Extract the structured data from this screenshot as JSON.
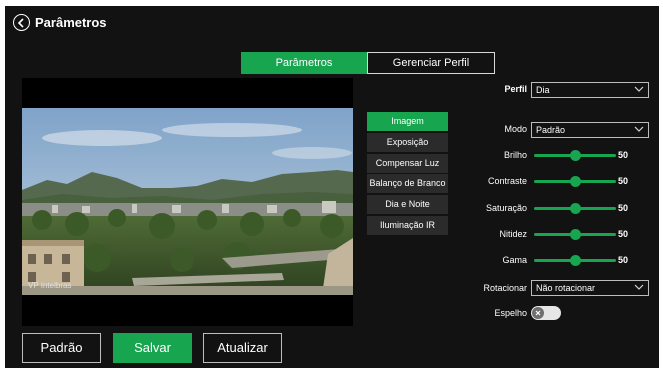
{
  "header": {
    "title": "Parâmetros"
  },
  "tabs": [
    {
      "label": "Parâmetros",
      "active": true
    },
    {
      "label": "Gerenciar Perfil",
      "active": false
    }
  ],
  "preview": {
    "watermark": "VP Intelbras"
  },
  "sub_menu": [
    {
      "label": "Imagem",
      "active": true
    },
    {
      "label": "Exposição",
      "active": false
    },
    {
      "label": "Compensar Luz",
      "active": false
    },
    {
      "label": "Balanço de Branco",
      "active": false
    },
    {
      "label": "Dia e Noite",
      "active": false
    },
    {
      "label": "Iluminação IR",
      "active": false
    }
  ],
  "settings": {
    "profile": {
      "label": "Perfil",
      "value": "Dia"
    },
    "mode": {
      "label": "Modo",
      "value": "Padrão"
    },
    "sliders": [
      {
        "label": "Brilho",
        "value": "50",
        "level": 0.5
      },
      {
        "label": "Contraste",
        "value": "50",
        "level": 0.5
      },
      {
        "label": "Saturação",
        "value": "50",
        "level": 0.5
      },
      {
        "label": "Nitidez",
        "value": "50",
        "level": 0.5
      },
      {
        "label": "Gama",
        "value": "50",
        "level": 0.5
      }
    ],
    "rotation": {
      "label": "Rotacionar",
      "value": "Não rotacionar"
    },
    "mirror": {
      "label": "Espelho",
      "enabled": false
    }
  },
  "buttons": {
    "default": "Padrão",
    "save": "Salvar",
    "refresh": "Atualizar"
  },
  "colors": {
    "accent": "#18a550",
    "background": "#121212",
    "panel": "#2b2b2b"
  },
  "icons": {
    "back": "back-arrow-icon",
    "dropdown": "chevron-down-icon",
    "toggle": "close-icon"
  }
}
